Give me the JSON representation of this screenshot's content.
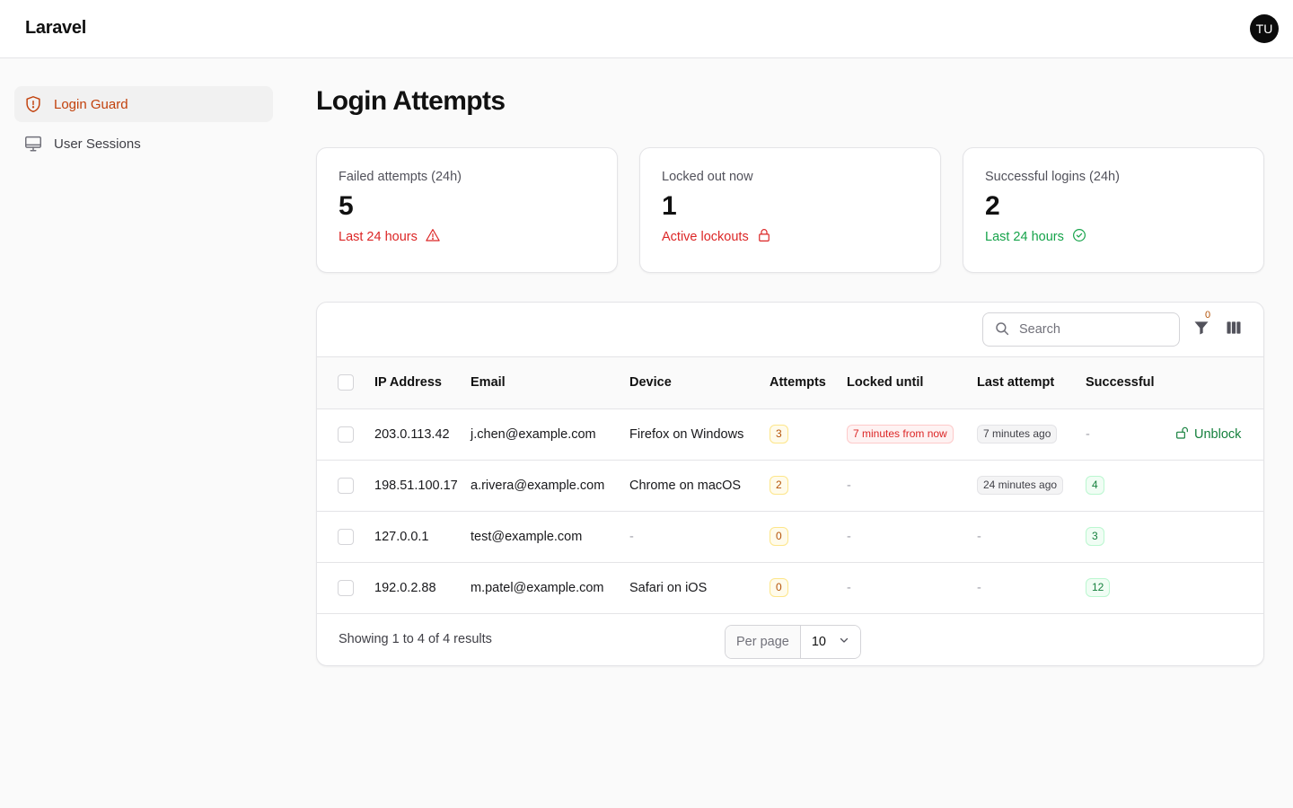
{
  "app": {
    "brand": "Laravel",
    "user_initials": "TU"
  },
  "sidebar": {
    "items": [
      {
        "label": "Login Guard",
        "icon": "shield-exclamation-icon",
        "active": true
      },
      {
        "label": "User Sessions",
        "icon": "computer-desktop-icon",
        "active": false
      }
    ]
  },
  "page": {
    "title": "Login Attempts"
  },
  "stats": [
    {
      "label": "Failed attempts (24h)",
      "value": "5",
      "desc": "Last 24 hours",
      "icon": "warning-triangle-icon",
      "color": "#dc2626"
    },
    {
      "label": "Locked out now",
      "value": "1",
      "desc": "Active lockouts",
      "icon": "lock-icon",
      "color": "#dc2626"
    },
    {
      "label": "Successful logins (24h)",
      "value": "2",
      "desc": "Last 24 hours",
      "icon": "check-circle-icon",
      "color": "#16a34a"
    }
  ],
  "toolbar": {
    "search_placeholder": "Search",
    "filter_count": "0"
  },
  "table": {
    "columns": [
      "IP Address",
      "Email",
      "Device",
      "Attempts",
      "Locked until",
      "Last attempt",
      "Successful"
    ],
    "rows": [
      {
        "ip": "203.0.113.42",
        "email": "j.chen@example.com",
        "device": "Firefox on Windows",
        "attempts": "3",
        "locked_until": "7 minutes from now",
        "last_attempt": "7 minutes ago",
        "successful": "-",
        "action": "Unblock"
      },
      {
        "ip": "198.51.100.17",
        "email": "a.rivera@example.com",
        "device": "Chrome on macOS",
        "attempts": "2",
        "locked_until": "-",
        "last_attempt": "24 minutes ago",
        "successful": "4",
        "action": ""
      },
      {
        "ip": "127.0.0.1",
        "email": "test@example.com",
        "device": "-",
        "attempts": "0",
        "locked_until": "-",
        "last_attempt": "-",
        "successful": "3",
        "action": ""
      },
      {
        "ip": "192.0.2.88",
        "email": "m.patel@example.com",
        "device": "Safari on iOS",
        "attempts": "0",
        "locked_until": "-",
        "last_attempt": "-",
        "successful": "12",
        "action": ""
      }
    ]
  },
  "pagination": {
    "summary": "Showing 1 to 4 of 4 results",
    "per_page_label": "Per page",
    "per_page_value": "10"
  },
  "colors": {
    "accent": "#c2410c",
    "danger": "#dc2626",
    "success": "#16a34a",
    "warning": "#b45309"
  }
}
